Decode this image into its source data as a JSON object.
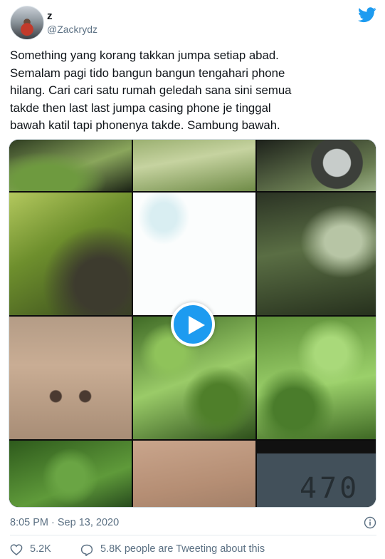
{
  "user": {
    "display_name": "z",
    "handle": "@Zackrydz"
  },
  "tweet": {
    "text": "Something yang korang takkan jumpa setiap abad.\nSemalam pagi tido bangun bangun tengahari phone\nhilang. Cari cari satu rumah geledah sana sini semua\ntakde then last last jumpa casing phone je tinggal\nbawah katil tapi phonenya takde. Sambung bawah."
  },
  "media": {
    "type": "video",
    "icon": "play-icon",
    "visible_numerals": "470"
  },
  "meta": {
    "timestamp": "8:05 PM · Sep 13, 2020"
  },
  "actions": {
    "like_count": "5.2K",
    "people_tweeting": "5.8K people are Tweeting about this"
  },
  "colors": {
    "accent": "#1d9bf0",
    "secondary_text": "#5b7083",
    "primary_text": "#0f1419"
  },
  "icons": [
    "twitter-bird-icon",
    "play-icon",
    "info-icon",
    "heart-icon",
    "comment-icon"
  ]
}
